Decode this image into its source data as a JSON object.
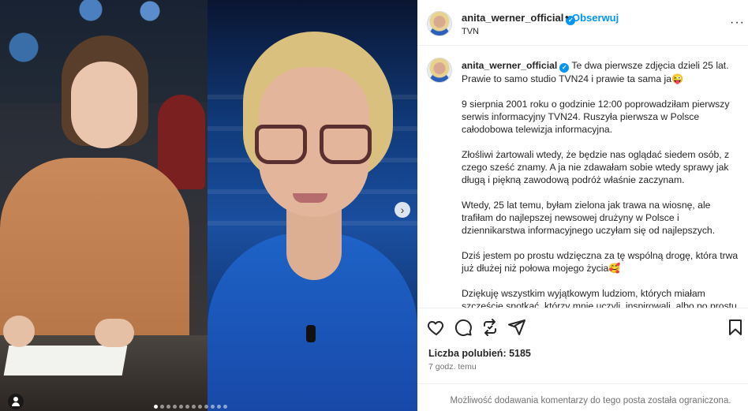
{
  "header": {
    "username": "anita_werner_official",
    "separator": "•",
    "follow_label": "Obserwuj",
    "subtitle": "TVN",
    "more_label": "···"
  },
  "media": {
    "next_label": "›",
    "carousel_dots": 12,
    "active_dot": 0
  },
  "caption": {
    "username": "anita_werner_official",
    "paragraphs": [
      "Te dwa pierwsze zdjęcia dzieli 25 lat. Prawie to samo studio TVN24 i prawie ta sama ja😜",
      "9 sierpnia 2001 roku o godzinie 12:00 poprowadziłam pierwszy serwis informacyjny TVN24. Ruszyła pierwsza w Polsce całodobowa telewizja informacyjna.",
      "Złośliwi żartowali wtedy, że będzie nas oglądać siedem osób, z czego sześć znamy. A ja nie zdawałam sobie wtedy sprawy jak długą i piękną zawodową podróż właśnie zaczynam.",
      "Wtedy, 25 lat temu, byłam zielona jak trawa na wiosnę, ale trafiłam do najlepszej newsowej drużyny w Polsce i dziennikarstwa informacyjnego uczyłam się od najlepszych.",
      "Dziś jestem po prostu wdzięczna za tę wspólną drogę, która trwa już dłużej niż połowa mojego życia🥰",
      "Dziękuję wszystkim wyjątkowym ludziom, których miałam szczęście spotkać, którzy mnie uczyli, inspirowali, albo po prostu przy mnie byli."
    ]
  },
  "engagement": {
    "likes_label": "Liczba polubień: 5185",
    "time_ago": "7 godz. temu"
  },
  "footer": {
    "restricted_text": "Możliwość dodawania komentarzy do tego posta została ograniczona."
  }
}
